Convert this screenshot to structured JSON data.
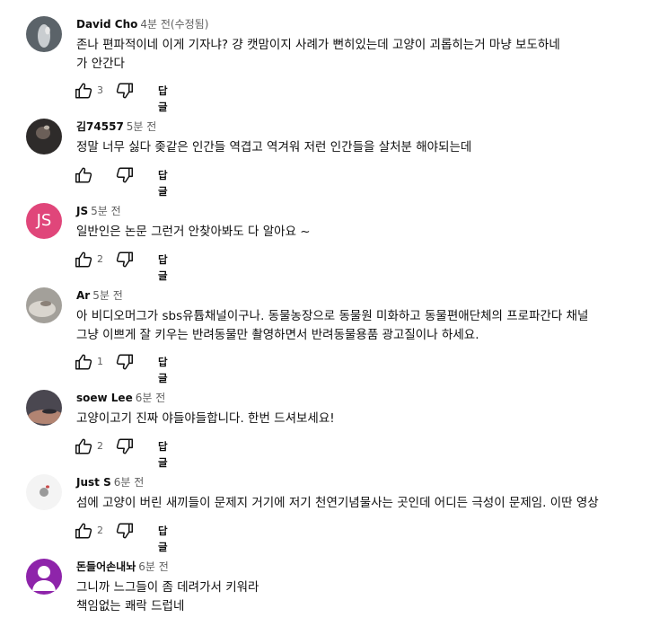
{
  "reply_label": "답글",
  "comments": [
    {
      "author": "David Cho",
      "time": "4분 전(수정됨)",
      "text": "존나 편파적이네 이게 기자냐? 걍 캣맘이지 사례가 뻔히있는데 고양이 괴롭히는거 마냥 보도하네\n가 안간다",
      "likes": "3",
      "avatar": {
        "type": "photo",
        "colors": [
          "#5b6369",
          "#c9cdd0",
          "#e8e8e8"
        ]
      }
    },
    {
      "author": "김74557",
      "time": "5분 전",
      "text": "정말 너무 싫다 좆같은 인간들 역겹고 역겨워 저런 인간들을 살처분 해야되는데",
      "likes": "",
      "avatar": {
        "type": "photo",
        "colors": [
          "#2e2b2a",
          "#6b5f58",
          "#bcb3a8"
        ]
      }
    },
    {
      "author": "JS",
      "time": "5분 전",
      "text": "일반인은 논문 그런거 안찾아봐도 다 알아요 ~",
      "likes": "2",
      "avatar": {
        "type": "letters",
        "letters": "JS",
        "color": "#e0467a"
      }
    },
    {
      "author": "Ar",
      "time": "5분 전",
      "text": "아 비디오머그가 sbs유튭채널이구나. 동물농장으로 동물원 미화하고 동물편애단체의 프로파간다 채널\n그냥 이쁘게 잘 키우는 반려동물만 촬영하면서 반려동물용품 광고질이나 하세요.",
      "likes": "1",
      "avatar": {
        "type": "photo",
        "colors": [
          "#a3a09a",
          "#d9d5ce",
          "#8b8178"
        ]
      }
    },
    {
      "author": "soew Lee",
      "time": "6분 전",
      "text": "고양이고기 진짜 야들야들합니다. 한번 드셔보세요!",
      "likes": "2",
      "avatar": {
        "type": "photo",
        "colors": [
          "#4a4750",
          "#b28472",
          "#2b2a30"
        ]
      }
    },
    {
      "author": "Just S",
      "time": "6분 전",
      "text": "섬에 고양이 버린 새끼들이 문제지 거기에 저기 천연기념물사는 곳인데 어디든 극성이 문제임. 이딴 영상",
      "likes": "2",
      "avatar": {
        "type": "photo",
        "colors": [
          "#f4f4f4",
          "#9a9a9a",
          "#c94a4a"
        ]
      }
    },
    {
      "author": "돈들어손내놔",
      "time": "6분 전",
      "text": "그니까 느그들이 좀 데려가서 키워라\n책임없는 쾌락 드럽네",
      "likes": "",
      "avatar": {
        "type": "default",
        "color": "#8e24aa"
      }
    }
  ]
}
